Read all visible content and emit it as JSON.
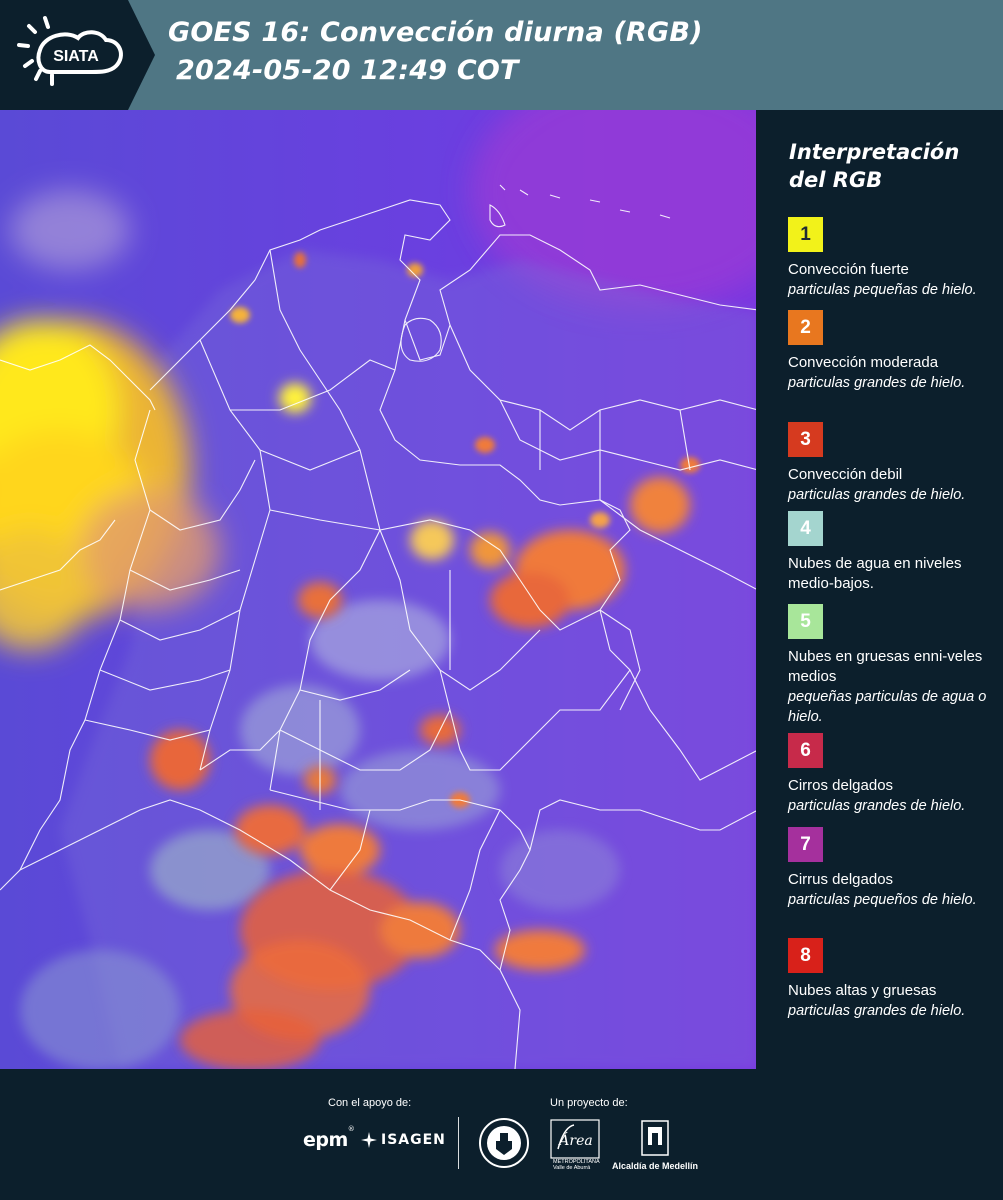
{
  "header": {
    "logo_text": "SIATA",
    "title_line1": "GOES 16: Convección diurna (RGB)",
    "title_line2": "2024-05-20 12:49 COT",
    "background": "#4f7684"
  },
  "legend": {
    "title": "Interpretación del RGB",
    "entries": [
      {
        "number": "1",
        "color": "#f2f21a",
        "text_color": "#1f2a33",
        "name": "Convección fuerte",
        "description": "particulas pequeñas de hielo."
      },
      {
        "number": "2",
        "color": "#e8771f",
        "text_color": "#ffffff",
        "name": "Convección moderada",
        "description": "particulas grandes de hielo."
      },
      {
        "number": "3",
        "color": "#d63a1f",
        "text_color": "#ffffff",
        "name": "Convección debil",
        "description": "particulas grandes de hielo."
      },
      {
        "number": "4",
        "color": "#a4d5cf",
        "text_color": "#ffffff",
        "name": "Nubes de agua en niveles medio-bajos.",
        "description": ""
      },
      {
        "number": "5",
        "color": "#a8e69a",
        "text_color": "#ffffff",
        "name": "Nubes en gruesas enni-veles medios",
        "description": "pequeñas particulas de agua o hielo."
      },
      {
        "number": "6",
        "color": "#c72a4a",
        "text_color": "#ffffff",
        "name": "Cirros delgados",
        "description": "particulas grandes de hielo."
      },
      {
        "number": "7",
        "color": "#a5309d",
        "text_color": "#ffffff",
        "name": "Cirrus delgados",
        "description": "particulas pequeños de hielo."
      },
      {
        "number": "8",
        "color": "#d8211a",
        "text_color": "#ffffff",
        "name": "Nubes altas y gruesas",
        "description": "particulas grandes de hielo."
      }
    ]
  },
  "footer": {
    "support_label": "Con el apoyo de:",
    "project_label": "Un proyecto de:",
    "epm": "epm",
    "isagen": "ISAGEN",
    "area_name": "Área",
    "area_sub": "METROPOLITANA",
    "area_sub2": "Valle de Aburrá",
    "alcaldia": "Alcaldía de Medellín"
  },
  "icons": [
    "siata-sun-cloud-icon",
    "isagen-star-icon",
    "gobernacion-seal-icon",
    "area-metropolitana-icon",
    "alcaldia-building-icon"
  ]
}
